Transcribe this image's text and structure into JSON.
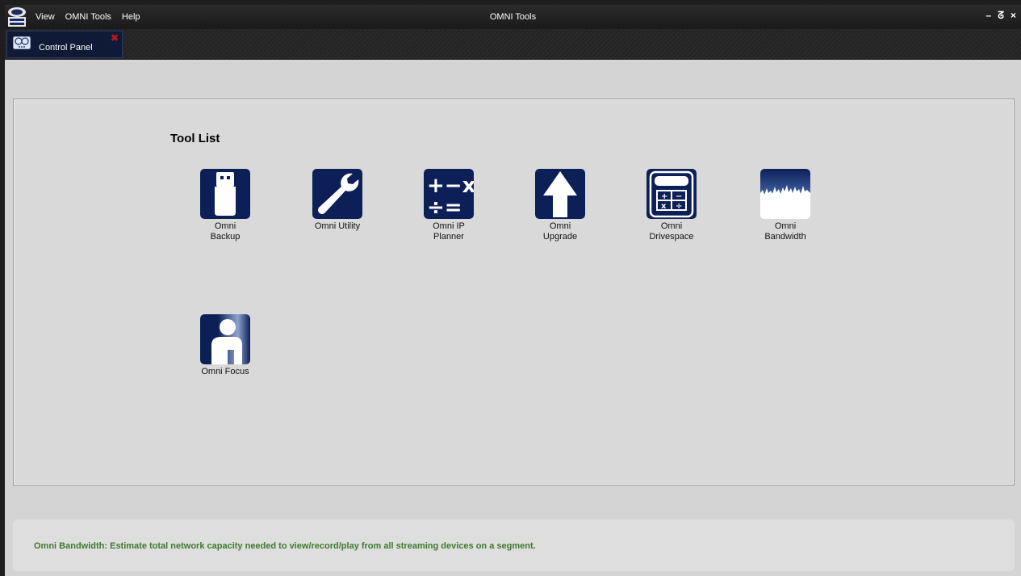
{
  "window": {
    "title": "OMNI Tools",
    "logo_text": "OMNI\nTOOLS"
  },
  "menu": [
    {
      "label": "View"
    },
    {
      "label": "OMNI Tools"
    },
    {
      "label": "Help"
    }
  ],
  "window_controls": {
    "minimize": "–",
    "restore": "ᘔ",
    "close": "×"
  },
  "tabs": [
    {
      "label": "Control Panel",
      "close": "✖"
    }
  ],
  "tool_panel": {
    "heading": "Tool List",
    "tools": [
      {
        "label": "Omni\nBackup",
        "icon": "usb-drive-icon"
      },
      {
        "label": "Omni Utility",
        "icon": "wrench-icon"
      },
      {
        "label": "Omni IP\nPlanner",
        "icon": "math-operators-icon"
      },
      {
        "label": "Omni\nUpgrade",
        "icon": "up-arrow-icon"
      },
      {
        "label": "Omni\nDrivespace",
        "icon": "calculator-icon"
      },
      {
        "label": "Omni\nBandwidth",
        "icon": "waveform-icon"
      },
      {
        "label": "Omni Focus",
        "icon": "person-focus-icon"
      }
    ]
  },
  "status": {
    "text": "Omni Bandwidth: Estimate total network capacity needed to view/record/play from all streaming devices on a segment."
  },
  "colors": {
    "icon_bg": "#0c1f57",
    "status_text": "#3e7a2e",
    "tab_bg": "#0e1a36",
    "close_x": "#b01818"
  }
}
